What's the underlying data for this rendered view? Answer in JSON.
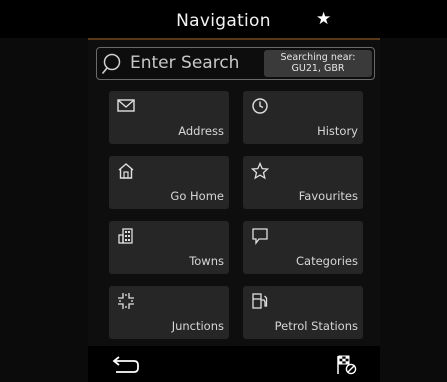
{
  "header": {
    "title": "Navigation",
    "favorite_icon": "star-icon"
  },
  "search": {
    "placeholder": "Enter Search",
    "near_line1": "Searching near:",
    "near_line2": "GU21, GBR"
  },
  "tiles": [
    {
      "label": "Address",
      "icon": "envelope-icon"
    },
    {
      "label": "History",
      "icon": "clock-icon"
    },
    {
      "label": "Go Home",
      "icon": "home-icon"
    },
    {
      "label": "Favourites",
      "icon": "star-outline-icon"
    },
    {
      "label": "Towns",
      "icon": "buildings-icon"
    },
    {
      "label": "Categories",
      "icon": "speech-bubble-icon"
    },
    {
      "label": "Junctions",
      "icon": "junction-icon"
    },
    {
      "label": "Petrol Stations",
      "icon": "fuel-pump-icon"
    }
  ],
  "footer": {
    "back_icon": "back-arrow-icon",
    "end_route_icon": "checkered-flag-cancel-icon"
  },
  "colors": {
    "accent": "#5a3a16",
    "tile": "#262626",
    "search_near_bg": "#3a3a3a"
  }
}
